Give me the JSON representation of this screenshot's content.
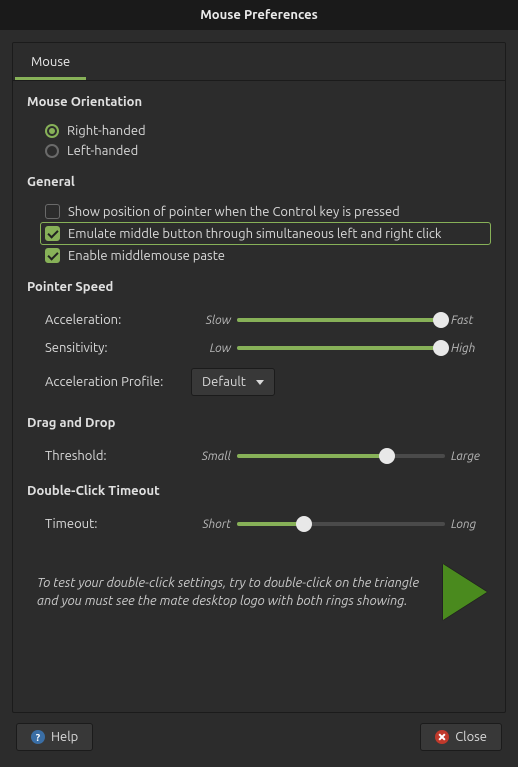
{
  "window": {
    "title": "Mouse Preferences"
  },
  "tabs": [
    {
      "label": "Mouse",
      "active": true
    }
  ],
  "sections": {
    "orientation": {
      "title": "Mouse Orientation",
      "options": [
        {
          "label": "Right-handed",
          "checked": true
        },
        {
          "label": "Left-handed",
          "checked": false
        }
      ]
    },
    "general": {
      "title": "General",
      "options": [
        {
          "label": "Show position of pointer when the Control key is pressed",
          "checked": false,
          "focused": false
        },
        {
          "label": "Emulate middle button through simultaneous left and right click",
          "checked": true,
          "focused": true
        },
        {
          "label": "Enable middlemouse paste",
          "checked": true,
          "focused": false
        }
      ]
    },
    "speed": {
      "title": "Pointer Speed",
      "sliders": [
        {
          "label": "Acceleration:",
          "min": "Slow",
          "max": "Fast",
          "value": 98
        },
        {
          "label": "Sensitivity:",
          "min": "Low",
          "max": "High",
          "value": 98
        }
      ],
      "profile": {
        "label": "Acceleration Profile:",
        "value": "Default"
      }
    },
    "drag": {
      "title": "Drag and Drop",
      "slider": {
        "label": "Threshold:",
        "min": "Small",
        "max": "Large",
        "value": 72
      }
    },
    "dclick": {
      "title": "Double-Click Timeout",
      "slider": {
        "label": "Timeout:",
        "min": "Short",
        "max": "Long",
        "value": 32
      },
      "test": "To test your double-click settings, try to double-click on the triangle and you must see the mate desktop logo with both rings showing."
    }
  },
  "footer": {
    "help": "Help",
    "close": "Close"
  }
}
